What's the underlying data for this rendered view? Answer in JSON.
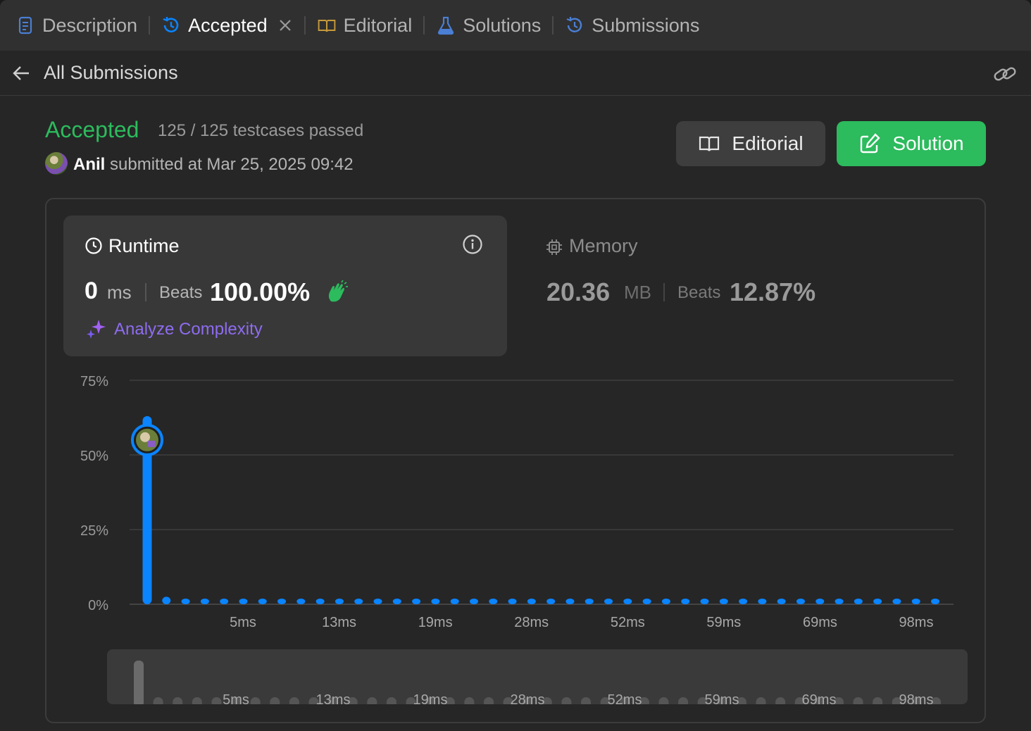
{
  "tabs": [
    {
      "label": "Description",
      "icon": "description-icon",
      "active": false
    },
    {
      "label": "Accepted",
      "icon": "history-icon",
      "active": true
    },
    {
      "label": "Editorial",
      "icon": "book-icon",
      "active": false
    },
    {
      "label": "Solutions",
      "icon": "flask-icon",
      "active": false
    },
    {
      "label": "Submissions",
      "icon": "history-icon",
      "active": false
    }
  ],
  "subbar": {
    "title": "All Submissions"
  },
  "result": {
    "status": "Accepted",
    "testcases": "125 / 125 testcases passed",
    "user": "Anil",
    "submitted": "submitted at Mar 25, 2025 09:42"
  },
  "buttons": {
    "editorial": "Editorial",
    "solution": "Solution"
  },
  "runtime": {
    "label": "Runtime",
    "value": "0",
    "unit": "ms",
    "beats_label": "Beats",
    "beats": "100.00%",
    "analyze": "Analyze Complexity"
  },
  "memory": {
    "label": "Memory",
    "value": "20.36",
    "unit": "MB",
    "beats_label": "Beats",
    "beats": "12.87%"
  },
  "colors": {
    "accent_green": "#2cbb5d",
    "bar_blue": "#0a84ff",
    "analyze_purple": "#8e6cf0"
  },
  "chart_data": {
    "type": "bar",
    "y_ticks": [
      "75%",
      "50%",
      "25%",
      "0%"
    ],
    "ylim": [
      0,
      75
    ],
    "x_tick_labels": [
      "5ms",
      "13ms",
      "19ms",
      "28ms",
      "52ms",
      "59ms",
      "69ms",
      "98ms"
    ],
    "bar_count": 42,
    "values": [
      63,
      2.5,
      1.5,
      1.5,
      1.5,
      1.5,
      1.5,
      1.5,
      1.5,
      1.5,
      1.5,
      1.5,
      1.5,
      1.5,
      1.5,
      1.5,
      1.5,
      1.5,
      1.5,
      1.5,
      1.5,
      1.5,
      1.5,
      1.5,
      1.5,
      1.5,
      1.5,
      1.5,
      1.5,
      1.5,
      1.5,
      1.5,
      1.5,
      1.5,
      1.5,
      1.5,
      1.5,
      1.5,
      1.5,
      1.5,
      1.5,
      1.5
    ],
    "highlight_index": 0,
    "highlight_value": 55,
    "grid": true
  }
}
